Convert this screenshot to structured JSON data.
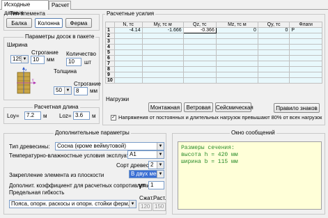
{
  "tabs": [
    {
      "label": "Исходные данные",
      "active": true
    },
    {
      "label": "Расчет",
      "active": false
    }
  ],
  "element_type": {
    "title": "Тип элемента",
    "buttons": [
      "Балка",
      "Колонна",
      "Ферма"
    ],
    "selected": "Колонна"
  },
  "board_params": {
    "title": "Параметры досок в пакете",
    "width_title": "Ширина",
    "width_value": "125",
    "planing_label": "Строгание",
    "planing_value": "10",
    "planing_unit": "мм",
    "count_label": "Количество",
    "count_value": "10",
    "count_unit": "шт",
    "thickness_title": "Толщина",
    "thickness_value": "50",
    "thickness_planing_label": "Строгание",
    "thickness_planing_value": "8",
    "thickness_unit": "мм"
  },
  "calc_length": {
    "title": "Расчетная длина",
    "loy_label": "Loy=",
    "loy_value": "7.2",
    "loz_label": "Loz=",
    "loz_value": "3.6",
    "unit": "м"
  },
  "forces": {
    "title": "Расчетные усилия",
    "columns": [
      "N, тс",
      "My, тс м",
      "Qz, тс",
      "Mz, тс м",
      "Qy, тс",
      "Флаги"
    ],
    "rows": [
      {
        "num": "1",
        "cells": [
          "-4.14",
          "-1.666",
          "-0.366",
          "0",
          "0",
          "P"
        ]
      },
      {
        "num": "2",
        "cells": [
          "",
          "",
          "",
          "",
          "",
          ""
        ]
      },
      {
        "num": "3",
        "cells": [
          "",
          "",
          "",
          "",
          "",
          ""
        ]
      },
      {
        "num": "4",
        "cells": [
          "",
          "",
          "",
          "",
          "",
          ""
        ]
      },
      {
        "num": "5",
        "cells": [
          "",
          "",
          "",
          "",
          "",
          ""
        ]
      },
      {
        "num": "6",
        "cells": [
          "",
          "",
          "",
          "",
          "",
          ""
        ]
      },
      {
        "num": "7",
        "cells": [
          "",
          "",
          "",
          "",
          "",
          ""
        ]
      },
      {
        "num": "8",
        "cells": [
          "",
          "",
          "",
          "",
          "",
          ""
        ]
      },
      {
        "num": "9",
        "cells": [
          "",
          "",
          "",
          "",
          "",
          ""
        ]
      },
      {
        "num": "10",
        "cells": [
          "",
          "",
          "",
          "",
          "",
          ""
        ]
      }
    ]
  },
  "loads": {
    "title": "Нагрузки",
    "buttons": [
      "Монтажная",
      "Ветровая",
      "Сейсмическая"
    ],
    "rules_button": "Правило знаков",
    "checkbox_label": "Напряжения от постоянных и длительных нагрузок превышают 80% от всех нагрузок",
    "checkbox_checked": true
  },
  "extra": {
    "title": "Дополнительные параметры",
    "wood_type_label": "Тип древесины:",
    "wood_type_value": "Сосна (кроме веймутовой)",
    "conditions_label": "Температурно-влажностные условия эксплуатации:",
    "conditions_value": "А1",
    "grade_label": "Сорт древесины:",
    "grade_value": "2",
    "fixing_label": "Закрепление элемента из плоскости",
    "fixing_value": "В двух местах",
    "coef_label": "Дополнит. коэффициент для расчетных сопротивлений:",
    "coef_symbol": "γ=",
    "coef_value": "1"
  },
  "slenderness": {
    "title": "Предельная гибкость",
    "value": "Пояса, опорн. раскосы и опорн. стойки ферм, колонны",
    "compress_label": "Сжат.",
    "compress_value": "120",
    "tension_label": "Раст.",
    "tension_value": "150"
  },
  "messages": {
    "title": "Окно сообщений",
    "lines": [
      "Размеры сечения:",
      "высота h = 420 мм",
      "ширина b = 115 мм"
    ]
  }
}
